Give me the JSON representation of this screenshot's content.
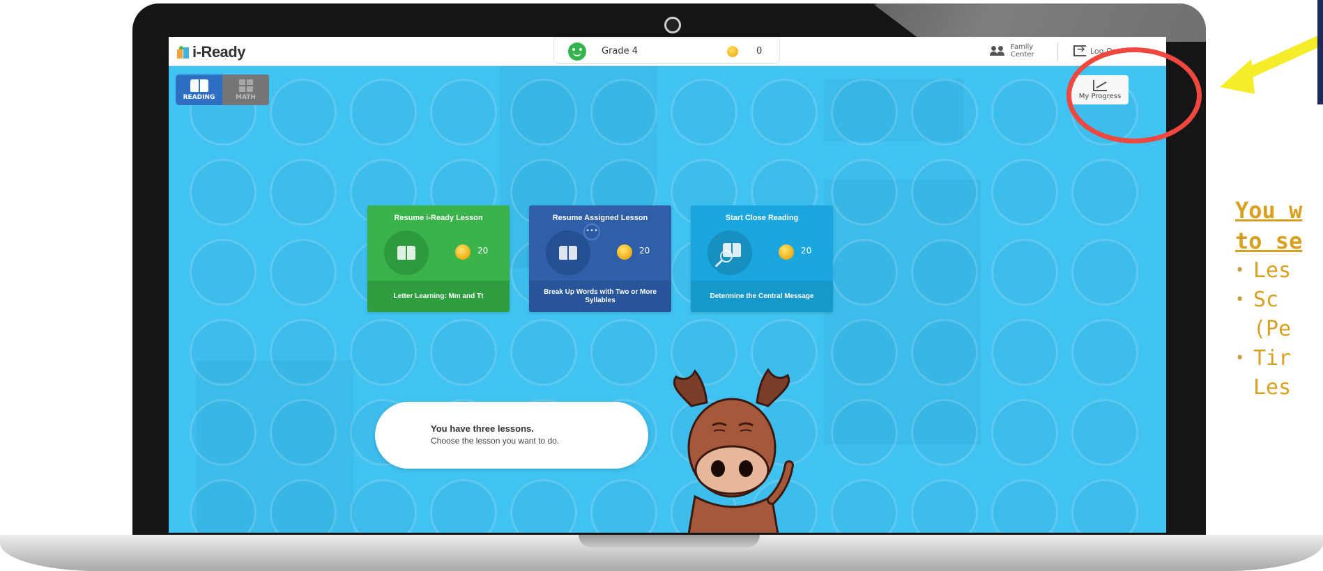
{
  "app": {
    "brand": "i-Ready"
  },
  "topbar": {
    "grade": "Grade 4",
    "coins": "0",
    "family_line1": "Family",
    "family_line2": "Center",
    "logout": "Log Out"
  },
  "subjects": [
    {
      "label": "READING",
      "active": true
    },
    {
      "label": "MATH",
      "active": false
    }
  ],
  "progress_button": {
    "label": "My Progress",
    "icon": "line-chart-icon"
  },
  "lessons": [
    {
      "title": "Resume i-Ready Lesson",
      "reward": "20",
      "name": "Letter Learning: Mm and Tt",
      "icon": "book-icon",
      "color": "#39b34a"
    },
    {
      "title": "Resume Assigned Lesson",
      "reward": "20",
      "name": "Break Up Words with Two or More Syllables",
      "icon": "book-icon",
      "color": "#2e5fa8"
    },
    {
      "title": "Start Close Reading",
      "reward": "20",
      "name": "Determine the Central Message",
      "icon": "magnify-book-icon",
      "color": "#1aa7df"
    }
  ],
  "speech": {
    "title": "You have three lessons.",
    "body": "Choose the lesson you want to do."
  },
  "annotation": {
    "title_line1": "You w",
    "title_line2": "to se",
    "bullets": [
      {
        "line1": "Les",
        "line2": ""
      },
      {
        "line1": "Sc",
        "line2": "(Pe"
      },
      {
        "line1": "Tir",
        "line2": "Les"
      }
    ],
    "highlight_color": "#f0473f",
    "arrow_color": "#f5ec2a",
    "text_color": "#d8a020"
  }
}
